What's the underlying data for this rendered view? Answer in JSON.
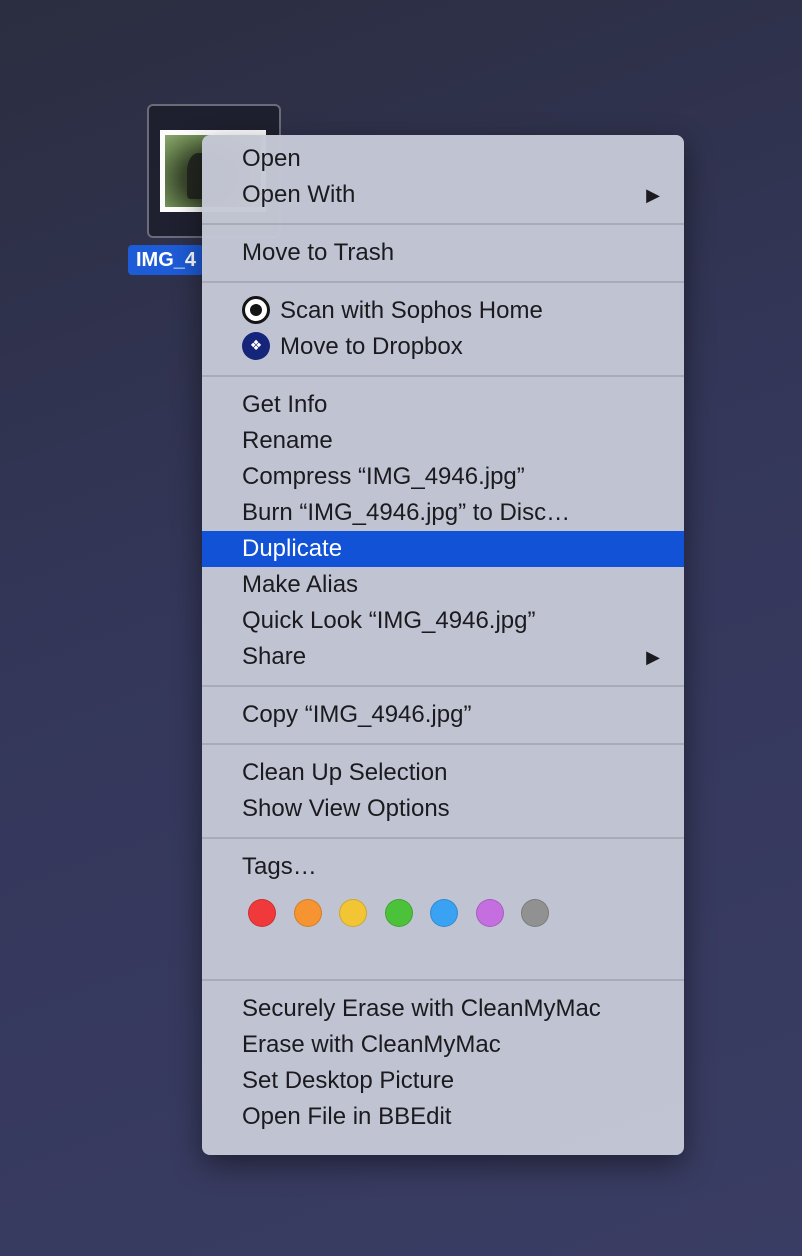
{
  "file": {
    "label": "IMG_4"
  },
  "menu": {
    "groups": [
      [
        {
          "label": "Open"
        },
        {
          "label": "Open With",
          "submenu": true
        }
      ],
      [
        {
          "label": "Move to Trash"
        }
      ],
      [
        {
          "label": "Scan with Sophos Home",
          "icon": "sophos-icon"
        },
        {
          "label": "Move to Dropbox",
          "icon": "dropbox-icon"
        }
      ],
      [
        {
          "label": "Get Info"
        },
        {
          "label": "Rename"
        },
        {
          "label": "Compress “IMG_4946.jpg”"
        },
        {
          "label": "Burn “IMG_4946.jpg” to Disc…"
        },
        {
          "label": "Duplicate",
          "highlighted": true
        },
        {
          "label": "Make Alias"
        },
        {
          "label": "Quick Look “IMG_4946.jpg”"
        },
        {
          "label": "Share",
          "submenu": true
        }
      ],
      [
        {
          "label": "Copy “IMG_4946.jpg”"
        }
      ],
      [
        {
          "label": "Clean Up Selection"
        },
        {
          "label": "Show View Options"
        }
      ],
      [
        {
          "label": "Tags…"
        }
      ],
      [
        {
          "label": "Securely Erase with CleanMyMac"
        },
        {
          "label": "Erase with CleanMyMac"
        },
        {
          "label": "Set Desktop Picture"
        },
        {
          "label": "Open File in BBEdit"
        }
      ]
    ],
    "submenu_arrow": "▶",
    "tag_colors": [
      {
        "name": "red",
        "color": "#f0393b"
      },
      {
        "name": "orange",
        "color": "#f59431"
      },
      {
        "name": "yellow",
        "color": "#f2c535"
      },
      {
        "name": "green",
        "color": "#4cc23a"
      },
      {
        "name": "blue",
        "color": "#3aa2f2"
      },
      {
        "name": "purple",
        "color": "#c56ee0"
      },
      {
        "name": "gray",
        "color": "#919191"
      }
    ]
  }
}
